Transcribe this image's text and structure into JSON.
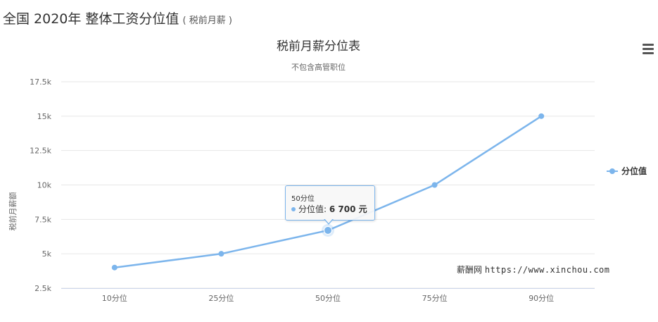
{
  "header": {
    "title": "全国 2020年 整体工资分位值",
    "subtitle": "( 税前月薪 )"
  },
  "chart_data": {
    "type": "line",
    "title": "税前月薪分位表",
    "subtitle": "不包含高管职位",
    "ylabel": "税前月薪额",
    "xlabel": "",
    "categories": [
      "10分位",
      "25分位",
      "50分位",
      "75分位",
      "90分位"
    ],
    "series": [
      {
        "name": "分位值",
        "values": [
          4000,
          5000,
          6700,
          10000,
          15000
        ],
        "color": "#7cb5ec"
      }
    ],
    "ylim": [
      2500,
      17500
    ],
    "yticks": [
      2500,
      5000,
      7500,
      10000,
      12500,
      15000,
      17500
    ],
    "ytick_labels": [
      "2.5k",
      "5k",
      "7.5k",
      "10k",
      "12.5k",
      "15k",
      "17.5k"
    ],
    "grid": true,
    "legend": "right",
    "tooltip": {
      "category": "50分位",
      "series": "分位值",
      "value_text": "6 700 元"
    },
    "credits": {
      "site": "薪酬网",
      "url": "https://www.xinchou.com"
    }
  }
}
